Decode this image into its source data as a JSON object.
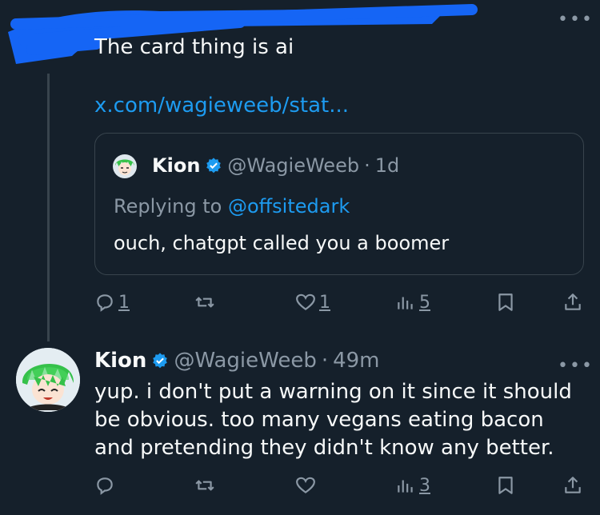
{
  "tweet1": {
    "text": "The card thing is ai",
    "link": "x.com/wagieweeb/stat..."
  },
  "quote": {
    "name": "Kion",
    "handle": "@WagieWeeb",
    "time_sep": "·",
    "time": "1d",
    "replying_prefix": "Replying to",
    "replying_to": "@offsitedark",
    "text": "ouch, chatgpt called you a boomer"
  },
  "actions1": {
    "replies": "1",
    "likes": "1",
    "views": "5"
  },
  "tweet2": {
    "name": "Kion",
    "handle": "@WagieWeeb",
    "time_sep": "·",
    "time": "49m",
    "lines": [
      "yup. i don't put a warning on it since it should",
      "be obvious. too many vegans eating bacon",
      "and pretending they didn't know any better."
    ]
  },
  "actions2": {
    "views": "3"
  },
  "colors": {
    "background": "#15202b",
    "accent": "#1d9bf0",
    "muted": "#8b98a5",
    "border": "#38444d",
    "scribble": "#1565f5"
  }
}
